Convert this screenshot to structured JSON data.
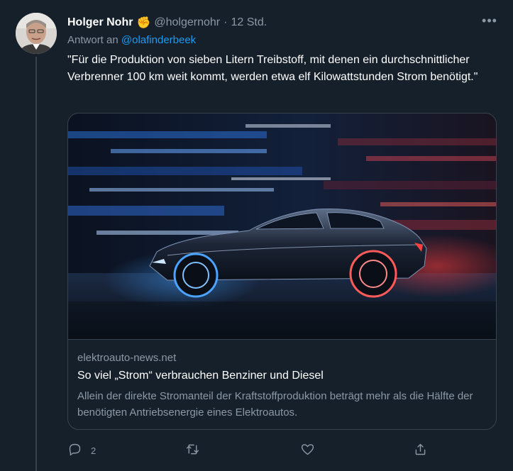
{
  "tweet": {
    "author_name": "Holger Nohr",
    "author_badge": "✊",
    "author_handle": "@holgernohr",
    "separator": "·",
    "time": "12 Std.",
    "reply_prefix": "Antwort an",
    "reply_mention": "@olafinderbeek",
    "text": "\"Für die Produktion von sieben Litern Treibstoff, mit denen ein durchschnittlicher Verbrenner 100 km weit kommt, werden etwa elf Kilowattstunden Strom benötigt.\"",
    "more_label": "•••",
    "card": {
      "domain": "elektroauto-news.net",
      "title": "So viel „Strom“ verbrauchen Benziner und Diesel",
      "description": "Allein der direkte Stromanteil der Kraftstoffproduktion beträgt mehr als die Hälfte der benötigten Antriebsenergie eines Elektroautos."
    },
    "actions": {
      "reply_count": "2",
      "retweet_count": "",
      "like_count": ""
    }
  },
  "colors": {
    "background": "#15202b",
    "text_primary": "#ffffff",
    "text_secondary": "#8b98a5",
    "link": "#1d9bf0",
    "border": "#38444d"
  },
  "icons": [
    "reply-icon",
    "retweet-icon",
    "like-icon",
    "share-icon",
    "more-icon"
  ]
}
